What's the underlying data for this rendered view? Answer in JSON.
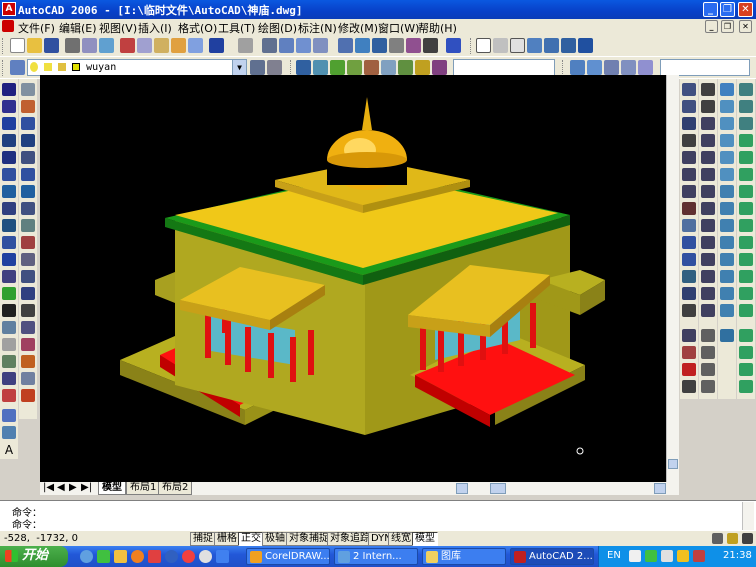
{
  "window": {
    "title": "AutoCAD 2006 - [I:\\临时文件\\AutoCAD\\神庙.dwg]",
    "app_icon": "A",
    "buttons": [
      "minimize-icon",
      "restore-icon",
      "close-icon"
    ]
  },
  "menu": {
    "items": [
      "文件(F)",
      "编辑(E)",
      "视图(V)",
      "插入(I)",
      "格式(O)",
      "工具(T)",
      "绘图(D)",
      "标注(N)",
      "修改(M)",
      "窗口(W)",
      "帮助(H)"
    ]
  },
  "layer_toolbar": {
    "layer_name": "wuyan",
    "style_combo": ""
  },
  "layout_tabs": {
    "nav": [
      "|◀",
      "◀",
      "▶",
      "▶|"
    ],
    "tabs": [
      "模型",
      "布局1",
      "布局2"
    ],
    "active": "模型"
  },
  "command": {
    "line1": "命令：",
    "line2": "命令："
  },
  "status": {
    "coordinates": "-528,  -1732, 0",
    "toggles": [
      {
        "label": "捕捉",
        "on": false
      },
      {
        "label": "栅格",
        "on": false
      },
      {
        "label": "正交",
        "on": true
      },
      {
        "label": "极轴",
        "on": false
      },
      {
        "label": "对象捕捉",
        "on": false
      },
      {
        "label": "对象追踪",
        "on": false
      },
      {
        "label": "DYN",
        "on": false
      },
      {
        "label": "线宽",
        "on": false
      },
      {
        "label": "模型",
        "on": true
      }
    ]
  },
  "taskbar": {
    "start_label": "开始",
    "tasks": [
      {
        "label": "CorelDRAW...",
        "icon": "coreldraw-icon",
        "active": false
      },
      {
        "label": "2 Intern...",
        "icon": "ie-icon",
        "active": false
      },
      {
        "label": "图库",
        "icon": "folder-icon",
        "active": false
      },
      {
        "label": "AutoCAD 2...",
        "icon": "autocad-icon",
        "active": true
      }
    ],
    "tray_lang": "EN",
    "clock": "21:38"
  },
  "colors": {
    "titlebar": "#0840c8",
    "viewport_bg": "#000000",
    "temple_yellow": "#e8c020",
    "temple_olive": "#b8b020",
    "roof_green": "#1a9a1a",
    "stairs_red": "#ff1010",
    "window_cyan": "#5ab8c8"
  }
}
